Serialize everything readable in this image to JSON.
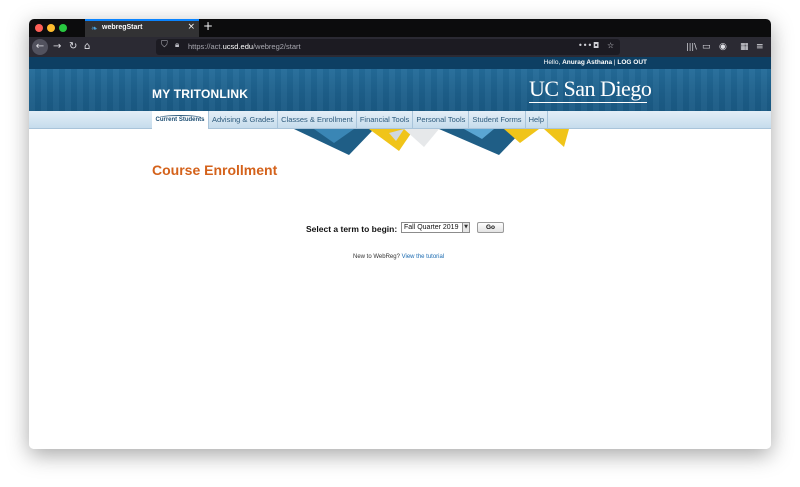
{
  "browser": {
    "tab_title": "webregStart",
    "url_scheme": "https://act.",
    "url_host": "ucsd.edu",
    "url_path": "/webreg2/start",
    "icons": [
      "back-arrow-icon",
      "forward-arrow-icon",
      "reload-icon",
      "home-icon",
      "shield-icon",
      "lock-icon",
      "more-icon",
      "pocket-icon",
      "bookmark-star-icon",
      "library-icon",
      "sidebar-icon",
      "account-icon",
      "extension-icon",
      "menu-icon"
    ]
  },
  "site": {
    "hello_prefix": "Hello, ",
    "user_name": "Anurag Asthana",
    "separator": " | ",
    "logout": "LOG OUT",
    "portal_title": "MY TRITONLINK",
    "logo_text": "UC San Diego"
  },
  "menu": {
    "items": [
      {
        "label": "Current Students",
        "current": true
      },
      {
        "label": "Advising & Grades"
      },
      {
        "label": "Classes & Enrollment"
      },
      {
        "label": "Financial Tools"
      },
      {
        "label": "Personal Tools"
      },
      {
        "label": "Student Forms"
      },
      {
        "label": "Help"
      }
    ]
  },
  "main": {
    "title": "Course Enrollment",
    "term_label": "Select a term to begin:",
    "term_selected": "Fall Quarter 2019",
    "go_label": "Go",
    "new_prefix": "New to WebReg? ",
    "tutorial_link": "View the tutorial"
  },
  "colors": {
    "title": "#d4621b",
    "banner": "#1d5f8a",
    "link": "#1a6ab0"
  }
}
